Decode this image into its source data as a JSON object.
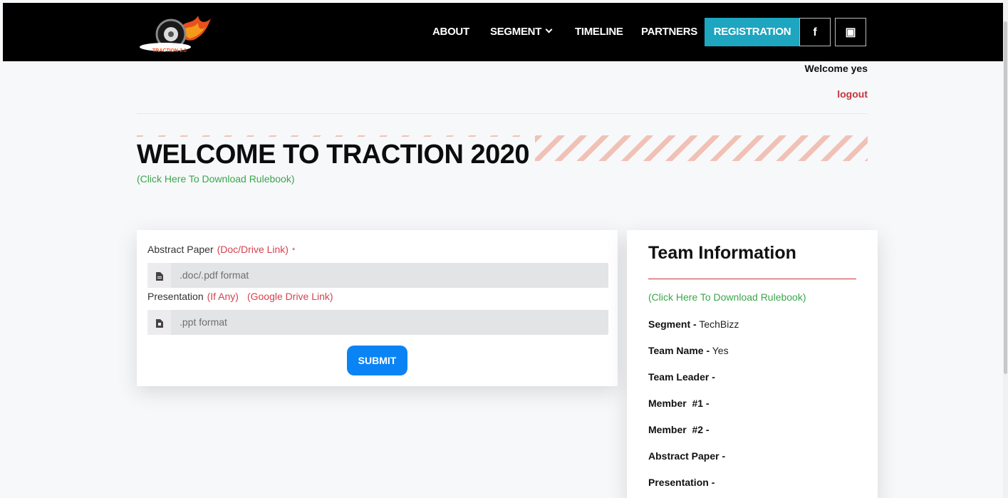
{
  "nav": {
    "logo_text": "TRACTION 2.0",
    "items": [
      "ABOUT",
      "SEGMENT",
      "TIMELINE",
      "PARTNERS"
    ],
    "register_label": "REGISTRATION",
    "facebook_label": "f",
    "discord_label": "▣"
  },
  "user": {
    "welcome": "Welcome yes",
    "logout": "logout"
  },
  "hero": {
    "title": "WELCOME TO TRACTION 2020",
    "rulebook_link": "(Click Here To Download Rulebook)"
  },
  "form": {
    "abstract_label": "Abstract Paper",
    "abstract_hint": "(Doc/Drive Link)",
    "abstract_required": "*",
    "abstract_placeholder": ".doc/.pdf format",
    "presentation_label": "Presentation",
    "presentation_hint1": "(If Any)",
    "presentation_hint2": "(Google Drive Link)",
    "presentation_placeholder": ".ppt format",
    "submit_label": "SUBMIT"
  },
  "team": {
    "title": "Team Information",
    "rulebook_link": "(Click Here To Download Rulebook)",
    "rows": [
      {
        "label": "Segment -",
        "value": "TechBizz"
      },
      {
        "label": "Team Name -",
        "value": "Yes"
      },
      {
        "label": "Team Leader -",
        "value": ""
      },
      {
        "label": "Member  #1 -",
        "value": ""
      },
      {
        "label": "Member  #2 -",
        "value": ""
      },
      {
        "label": "Abstract Paper -",
        "value": ""
      },
      {
        "label": "Presentation -",
        "value": ""
      }
    ]
  },
  "colors": {
    "nav_bg": "#000000",
    "accent": "#1ea5c0",
    "link_green": "#3aa64b",
    "red": "#c8323c",
    "button_blue": "#0a84f5"
  }
}
